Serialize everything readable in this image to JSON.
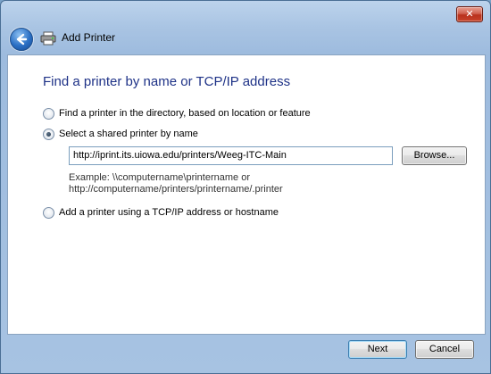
{
  "window": {
    "title": "Add Printer",
    "close_glyph": "✕"
  },
  "wizard": {
    "heading": "Find a printer by name or TCP/IP address",
    "options": [
      {
        "label": "Find a printer in the directory, based on location or feature",
        "selected": false
      },
      {
        "label": "Select a shared printer by name",
        "selected": true
      },
      {
        "label": "Add a printer using a TCP/IP address or hostname",
        "selected": false
      }
    ],
    "shared_printer_value": "http://iprint.its.uiowa.edu/printers/Weeg-ITC-Main",
    "browse_label": "Browse...",
    "example_line1": "Example: \\\\computername\\printername or",
    "example_line2": "http://computername/printers/printername/.printer"
  },
  "footer": {
    "next_label": "Next",
    "cancel_label": "Cancel"
  },
  "icons": {
    "back": "back-arrow-icon",
    "printer": "printer-icon",
    "close": "close-icon"
  }
}
